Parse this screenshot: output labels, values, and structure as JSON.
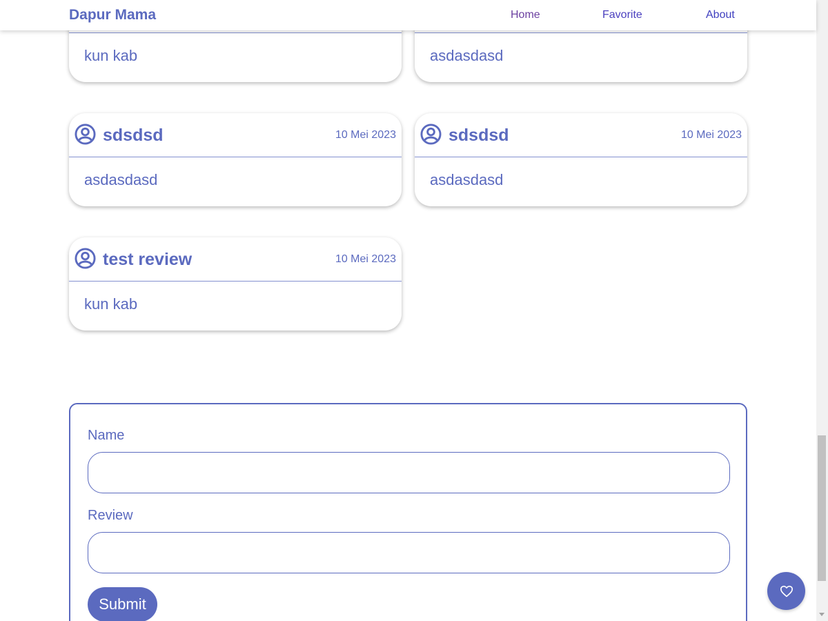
{
  "header": {
    "brand": "Dapur Mama",
    "nav": [
      {
        "label": "Home"
      },
      {
        "label": "Favorite"
      },
      {
        "label": "About"
      }
    ]
  },
  "reviews": [
    {
      "name": "",
      "date": "",
      "text": "kun kab"
    },
    {
      "name": "",
      "date": "",
      "text": "asdasdasd"
    },
    {
      "name": "sdsdsd",
      "date": "10 Mei 2023",
      "text": "asdasdasd"
    },
    {
      "name": "sdsdsd",
      "date": "10 Mei 2023",
      "text": "asdasdasd"
    },
    {
      "name": "test review",
      "date": "10 Mei 2023",
      "text": "kun kab"
    }
  ],
  "form": {
    "name_label": "Name",
    "name_value": "",
    "review_label": "Review",
    "review_value": "",
    "submit_label": "Submit"
  },
  "fab": {
    "icon": "heart-icon"
  },
  "colors": {
    "primary": "#5b6abf",
    "background": "#ffffff"
  }
}
